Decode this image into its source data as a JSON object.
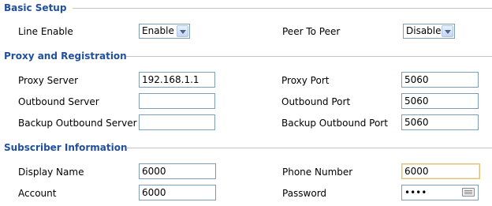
{
  "basic_setup": {
    "title": "Basic Setup",
    "line_enable": {
      "label": "Line Enable",
      "value": "Enable"
    },
    "peer_to_peer": {
      "label": "Peer To Peer",
      "value": "Disable"
    }
  },
  "proxy": {
    "title": "Proxy and Registration",
    "proxy_server": {
      "label": "Proxy Server",
      "value": "192.168.1.1"
    },
    "proxy_port": {
      "label": "Proxy Port",
      "value": "5060"
    },
    "outbound_server": {
      "label": "Outbound Server",
      "value": ""
    },
    "outbound_port": {
      "label": "Outbound Port",
      "value": "5060"
    },
    "backup_outbound_server": {
      "label": "Backup Outbound Server",
      "value": ""
    },
    "backup_outbound_port": {
      "label": "Backup Outbound Port",
      "value": "5060"
    }
  },
  "subscriber": {
    "title": "Subscriber Information",
    "display_name": {
      "label": "Display Name",
      "value": "6000"
    },
    "phone_number": {
      "label": "Phone Number",
      "value": "6000"
    },
    "account": {
      "label": "Account",
      "value": "6000"
    },
    "password": {
      "label": "Password",
      "value": "••••"
    }
  },
  "icons": {
    "select_arrow": "chevron-down-icon",
    "password_keyboard": "keyboard-icon"
  }
}
